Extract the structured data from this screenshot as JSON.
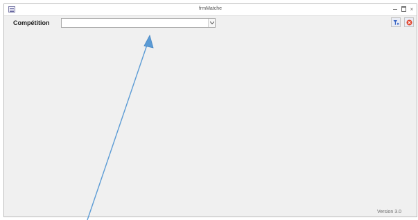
{
  "window": {
    "title": "frmMatche",
    "minimize_icon": "minimize-icon",
    "restore_icon": "restore-icon",
    "close_icon": "close-icon",
    "close_glyph": "×"
  },
  "form": {
    "competition_label": "Compétition",
    "competition_value": ""
  },
  "toolbar": {
    "filter_icon": "filter-icon",
    "quit_icon": "exit-icon"
  },
  "footer": {
    "version": "Version 3.0"
  },
  "colors": {
    "background": "#f0f0f0",
    "annotation_arrow": "#5b9bd5"
  }
}
